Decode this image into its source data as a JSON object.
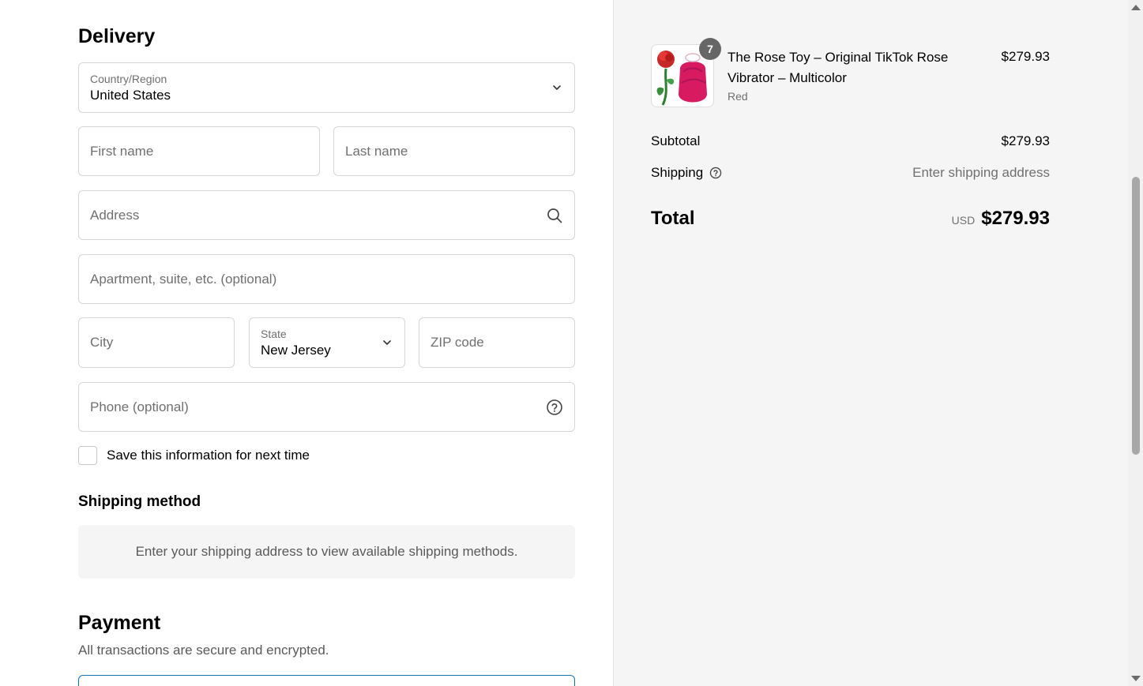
{
  "delivery": {
    "title": "Delivery",
    "country": {
      "label": "Country/Region",
      "value": "United States"
    },
    "first_name": {
      "placeholder": "First name"
    },
    "last_name": {
      "placeholder": "Last name"
    },
    "address": {
      "placeholder": "Address"
    },
    "apartment": {
      "placeholder": "Apartment, suite, etc. (optional)"
    },
    "city": {
      "placeholder": "City"
    },
    "state": {
      "label": "State",
      "value": "New Jersey"
    },
    "zip": {
      "placeholder": "ZIP code"
    },
    "phone": {
      "placeholder": "Phone (optional)"
    },
    "save_info_label": "Save this information for next time"
  },
  "shipping_method": {
    "title": "Shipping method",
    "message": "Enter your shipping address to view available shipping methods."
  },
  "payment": {
    "title": "Payment",
    "subtitle": "All transactions are secure and encrypted."
  },
  "order_summary": {
    "item": {
      "quantity": "7",
      "name": "The Rose Toy – Original TikTok Rose Vibrator – Multicolor",
      "variant": "Red",
      "price": "$279.93"
    },
    "subtotal_label": "Subtotal",
    "subtotal_value": "$279.93",
    "shipping_label": "Shipping",
    "shipping_value": "Enter shipping address",
    "total_label": "Total",
    "total_currency": "USD",
    "total_value": "$279.93"
  },
  "colors": {
    "accent": "#1773b0",
    "summary_bg": "#f5f5f5",
    "border": "#d6d6d6",
    "muted_text": "#707070"
  }
}
